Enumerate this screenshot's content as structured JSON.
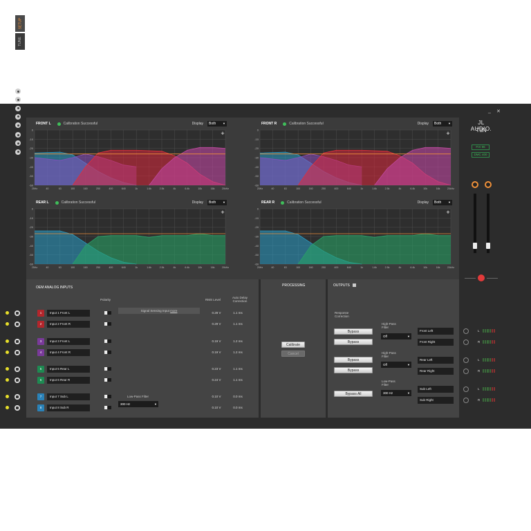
{
  "brand": {
    "logo": "JL AUDIO.",
    "product": "TüN"
  },
  "window": {
    "minimize": "_",
    "close": "✕"
  },
  "firmware": [
    "FIX 96",
    "DMC 400"
  ],
  "tabs": [
    "SETUP",
    "TUNE"
  ],
  "freq_ticks": [
    "25Hz",
    "40",
    "63",
    "100",
    "160",
    "250",
    "400",
    "640",
    "1k",
    "1.6k",
    "2.5k",
    "4k",
    "6.4k",
    "10k",
    "16k",
    "20kHz"
  ],
  "db_ticks": [
    "0",
    "-10",
    "-20",
    "-30",
    "-40",
    "-50",
    "-60"
  ],
  "graphs": [
    {
      "name": "FRONT L",
      "status": "Calibration Successful",
      "display_label": "Display",
      "display_value": "Both",
      "plus": "+"
    },
    {
      "name": "FRONT R",
      "status": "Calibration Successful",
      "display_label": "Display",
      "display_value": "Both",
      "plus": "+"
    },
    {
      "name": "REAR L",
      "status": "Calibration Successful",
      "display_label": "Display",
      "display_value": "Both",
      "plus": "+"
    },
    {
      "name": "REAR R",
      "status": "Calibration Successful",
      "display_label": "Display",
      "display_value": "Both",
      "plus": "+"
    }
  ],
  "oem_inputs": {
    "title": "OEM ANALOG INPUTS",
    "polarity_label": "Polarity",
    "rms_label": "RMS Level",
    "delay_label": "Auto Delay Correction",
    "signal_sensing": "Signal Sensing Input",
    "signal_sensing_link": "more",
    "lowpass_label": "Low-Pass Filter",
    "lowpass_value": "300 Hz",
    "inputs": [
      {
        "num": "1",
        "name": "Input 1 Front L",
        "rms": "0.28 V",
        "delay": "1.1 ms",
        "color": "#b3262c"
      },
      {
        "num": "2",
        "name": "Input 2 Front R",
        "rms": "0.29 V",
        "delay": "1.1 ms",
        "color": "#b3262c"
      },
      {
        "num": "3",
        "name": "Input 3 Front L",
        "rms": "0.19 V",
        "delay": "1.2 ms",
        "color": "#7a3a9a"
      },
      {
        "num": "4",
        "name": "Input 4 Front R",
        "rms": "0.19 V",
        "delay": "1.2 ms",
        "color": "#7a3a9a"
      },
      {
        "num": "5",
        "name": "Input 5 Rear L",
        "rms": "0.23 V",
        "delay": "1.1 ms",
        "color": "#1e8a52"
      },
      {
        "num": "6",
        "name": "Input 6 Rear R",
        "rms": "0.24 V",
        "delay": "1.1 ms",
        "color": "#1e8a52"
      },
      {
        "num": "7",
        "name": "Input 7 Sub L",
        "rms": "0.10 V",
        "delay": "0.0 ms",
        "color": "#2a82b8"
      },
      {
        "num": "8",
        "name": "Input 8 Sub R",
        "rms": "0.10 V",
        "delay": "0.0 ms",
        "color": "#2a82b8"
      }
    ]
  },
  "processing": {
    "title": "PROCESSING",
    "calibrate": "Calibrate",
    "cancel": "Cancel"
  },
  "outputs": {
    "title": "OUTPUTS",
    "response_correction": "Response Correction",
    "bypass": "Bypass",
    "bypass_all": "Bypass All",
    "highpass_label": "High-Pass Filter",
    "lowpass_label": "Low-Pass Filter",
    "hp1_value": "Off",
    "hp2_value": "Off",
    "lp_value": "300 Hz",
    "channels": [
      {
        "name": "Front Left",
        "side": "L"
      },
      {
        "name": "Front Right",
        "side": "R"
      },
      {
        "name": "Rear Left",
        "side": "L"
      },
      {
        "name": "Rear Right",
        "side": "R"
      },
      {
        "name": "Sub Left",
        "side": "L"
      },
      {
        "name": "Sub Right",
        "side": "R"
      }
    ]
  }
}
